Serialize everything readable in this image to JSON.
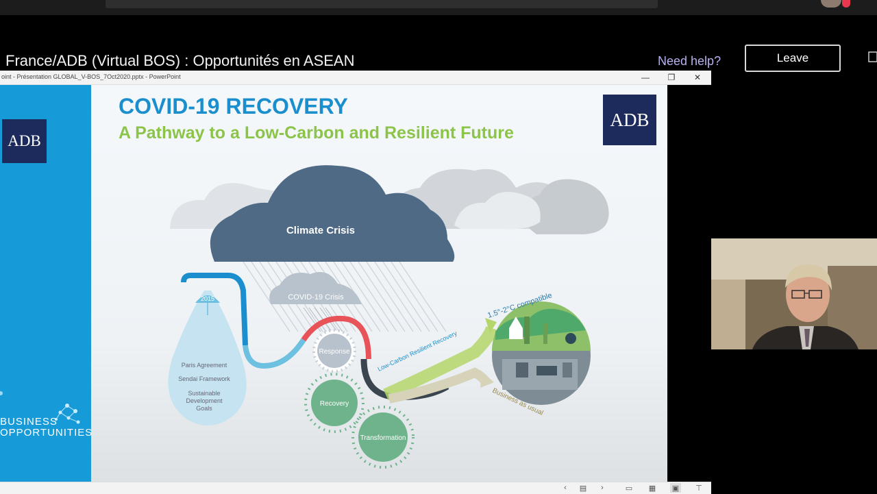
{
  "meeting": {
    "title": "France/ADB (Virtual BOS) : Opportunités en ASEAN",
    "need_help": "Need help?",
    "leave": "Leave"
  },
  "ppt": {
    "window_title": "oint  -  Présentation GLOBAL_V-BOS_7Oct2020.pptx  -  PowerPoint",
    "controls": {
      "minimize": "—",
      "restore": "❐",
      "close": "✕"
    }
  },
  "slide": {
    "logo_text": "ADB",
    "title": "COVID-19 RECOVERY",
    "subtitle": "A Pathway to a Low-Carbon and Resilient Future",
    "left_brand_line1": "BUSINESS",
    "left_brand_line2": "OPPORTUNITIES",
    "climate_crisis": "Climate Crisis",
    "covid_crisis": "COVID-19 Crisis",
    "year": "2015",
    "drop_lines": [
      "Paris Agreement",
      "Sendai Framework",
      "Sustainable",
      "Development",
      "Goals"
    ],
    "stages": [
      "Response",
      "Recovery",
      "Transformation"
    ],
    "low_carbon": "Low-Carbon Resilient Recovery",
    "compatible": "1.5°-2°C compatible",
    "business_as_usual": "Business as usual"
  },
  "colors": {
    "title_blue": "#1b8fcd",
    "subtitle_green": "#8cc44a",
    "cloud_dark": "#4f6a85",
    "adb_navy": "#1d2b5c",
    "left_bar": "#169bd8",
    "stage_green": "#6fb38c"
  },
  "icons": {
    "prev": "chevron-left-icon",
    "notes": "notes-icon",
    "next": "chevron-right-icon",
    "normal_view": "normal-view-icon",
    "sorter_view": "slide-sorter-icon",
    "reading_view": "reading-view-icon",
    "present": "slideshow-icon"
  }
}
